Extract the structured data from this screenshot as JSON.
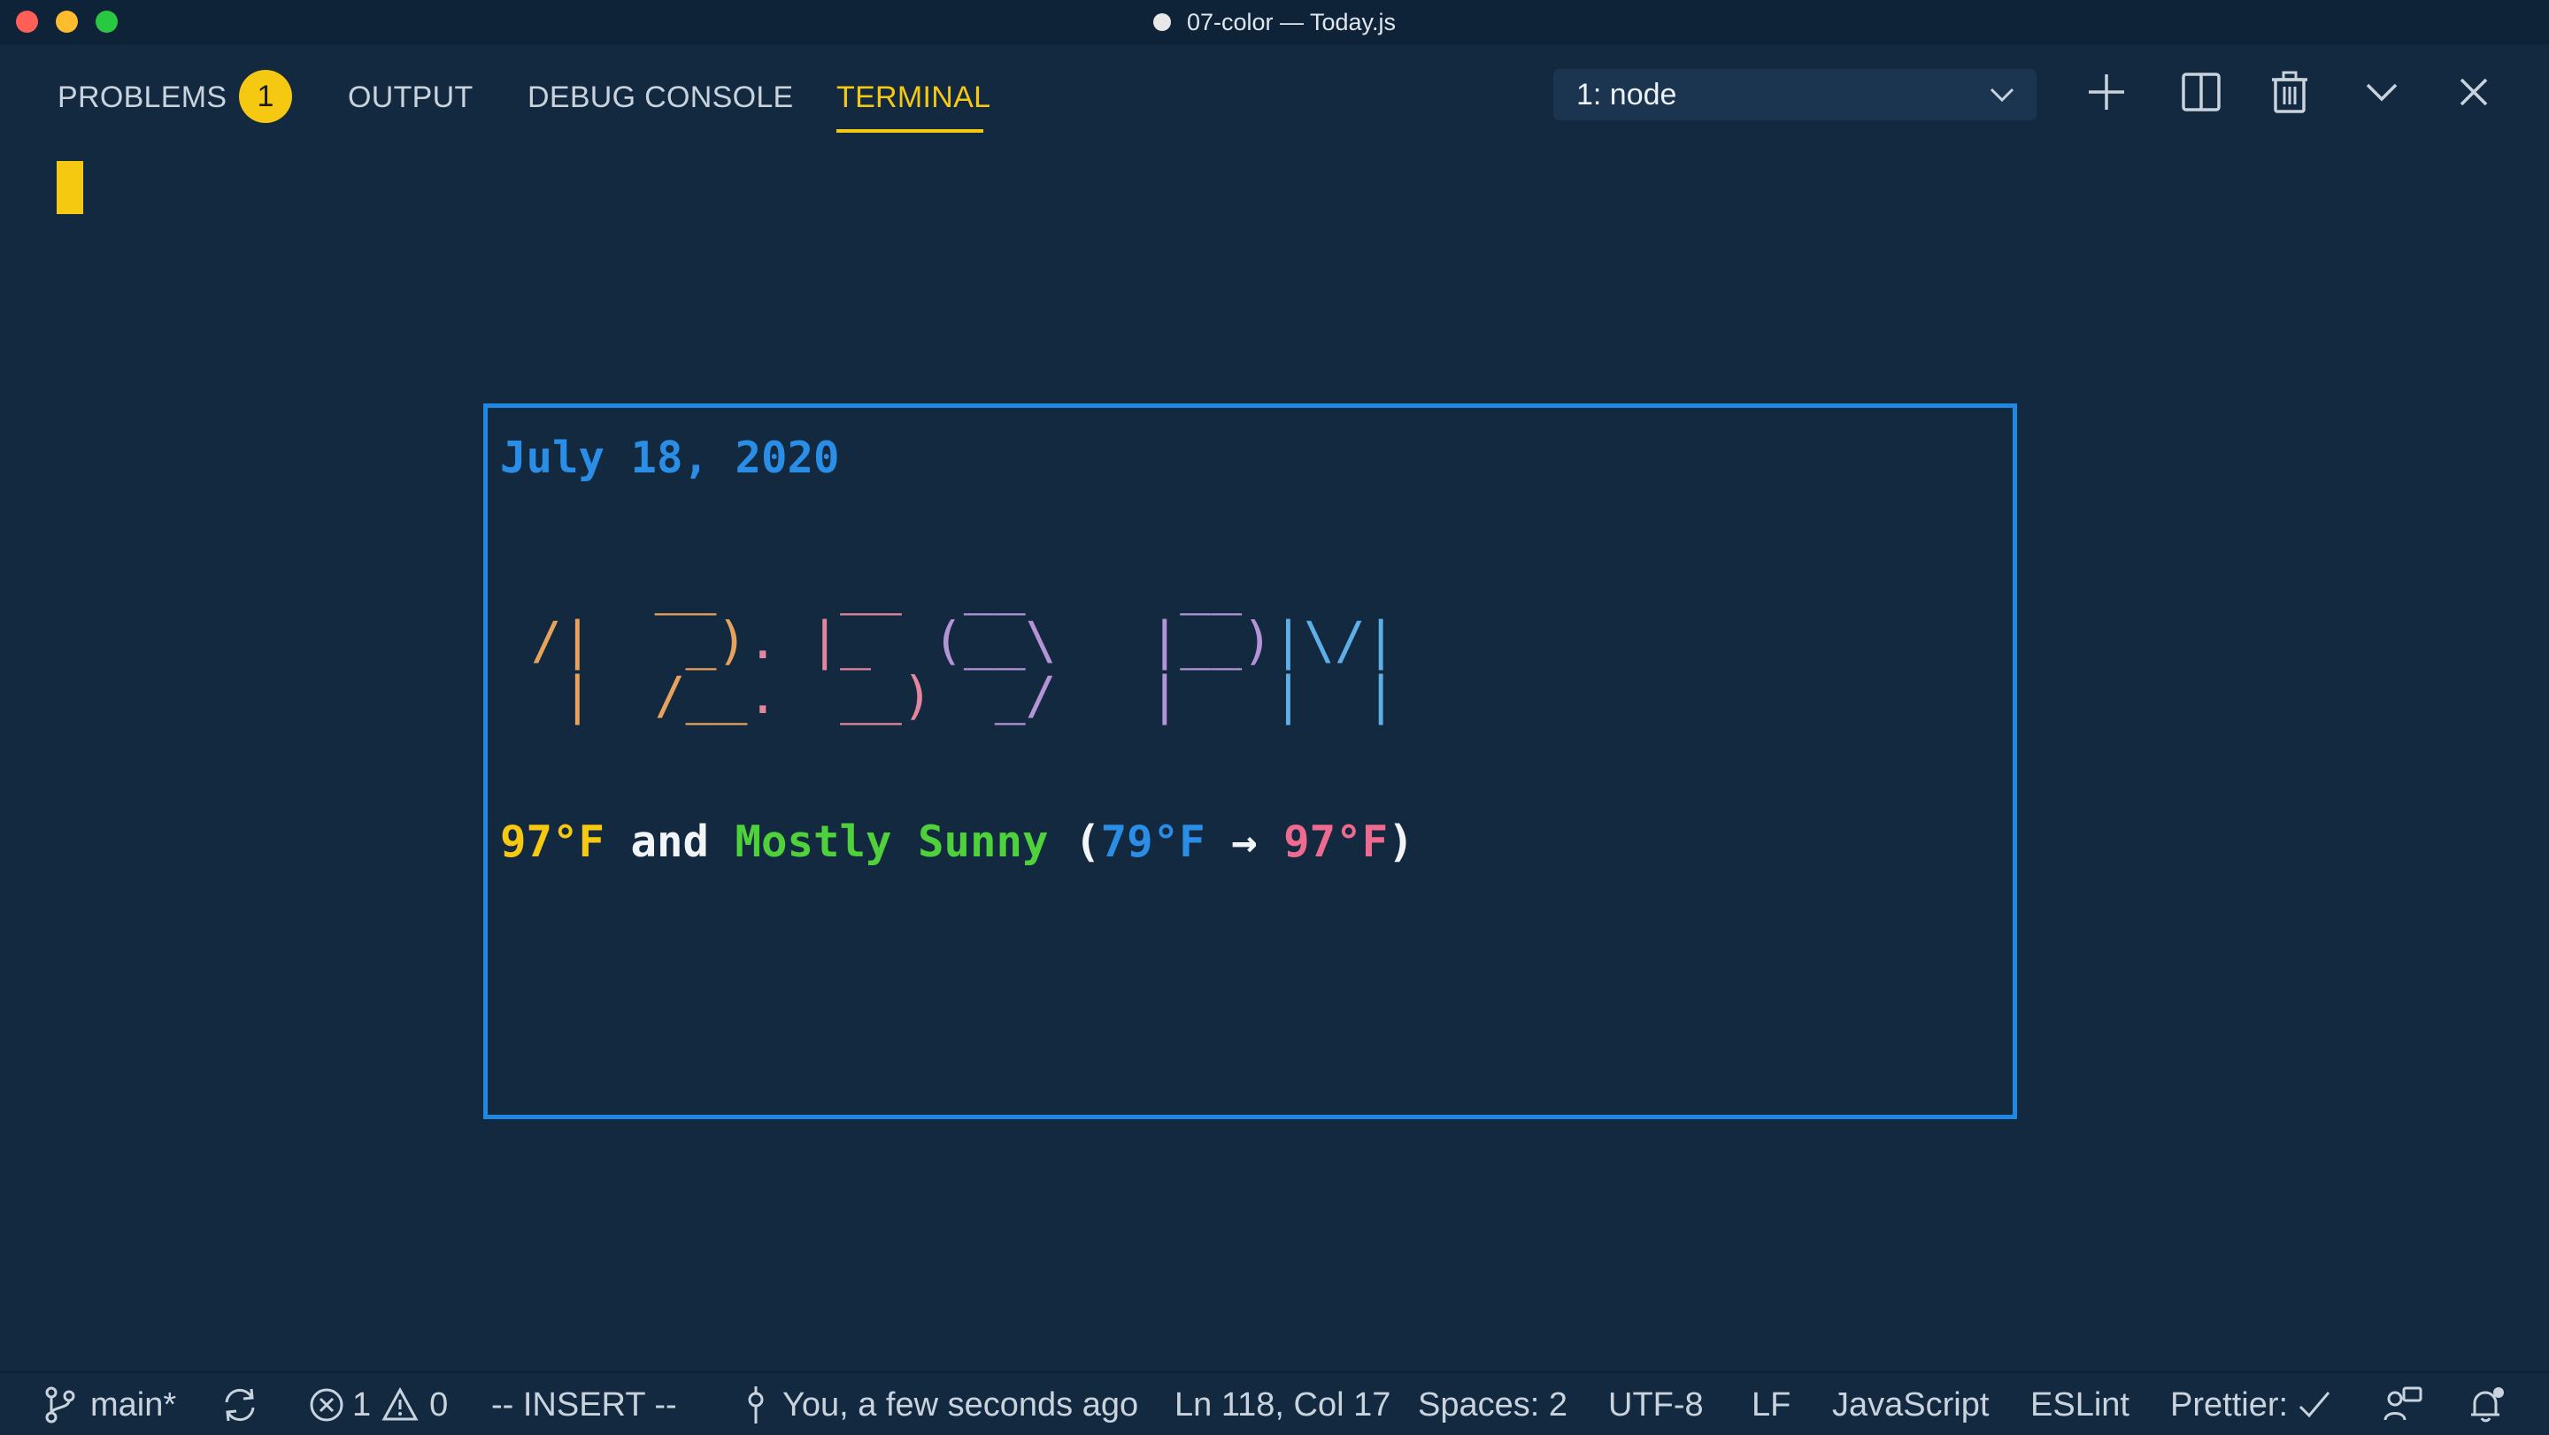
{
  "window": {
    "title": "07-color — Today.js"
  },
  "panel": {
    "tabs": {
      "problems": "PROBLEMS",
      "output": "OUTPUT",
      "debug_console": "DEBUG CONSOLE",
      "terminal": "TERMINAL"
    },
    "problems_badge": "1",
    "active_tab": "TERMINAL",
    "terminal_selector": "1: node"
  },
  "terminal": {
    "date": "July 18, 2020",
    "clock_value": "12:59 PM",
    "clock_ascii": {
      "row1": {
        "hour1": "    ",
        "hour2": " __ ",
        "colon": "  ",
        "min1": " __ ",
        "min2": " __  ",
        "space": "  ",
        "p": " __ ",
        "m": "    "
      },
      "row2": {
        "hour1": " /| ",
        "hour2": "  _)",
        "colon": ". ",
        "min1": "|_  ",
        "min2": "(__\\ ",
        "space": "  ",
        "p": "|__)",
        "m": "|\\/|"
      },
      "row3": {
        "hour1": "  | ",
        "hour2": " /__",
        "colon": ". ",
        "min1": " __)",
        "min2": "  _/ ",
        "space": "  ",
        "p": "|   ",
        "m": "|  |"
      }
    },
    "weather": {
      "current_temp": "97°F",
      "connector": " and ",
      "condition": "Mostly Sunny",
      "open_paren": " (",
      "low_temp": "79°F",
      "arrow": " → ",
      "high_temp": "97°F",
      "close_paren": ")"
    }
  },
  "statusbar": {
    "branch": "main*",
    "errors": "1",
    "warnings": "0",
    "mode": "-- INSERT --",
    "blame": "You, a few seconds ago",
    "position": "Ln 118, Col 17",
    "spaces": "Spaces: 2",
    "encoding": "UTF-8",
    "eol": "LF",
    "language": "JavaScript",
    "linter": "ESLint",
    "prettier": "Prettier:"
  },
  "colors": {
    "accent_yellow": "#f5c812",
    "widget_border": "#1f88e5",
    "date_blue": "#2b8ee6",
    "clock_orange": "#e8a25c",
    "clock_pink": "#e3869e",
    "clock_purple": "#b493d6",
    "clock_blue": "#5eaee8",
    "weather_green": "#4ed13b",
    "weather_pink": "#ee6b8f",
    "background": "#12293f"
  },
  "icons": {
    "problems_badge": "count-badge",
    "selector": "chevron-down-icon",
    "add": "plus-icon",
    "split": "split-terminal-icon",
    "kill": "trash-icon",
    "maximize": "chevron-down-icon",
    "close": "close-icon",
    "branch": "git-branch-icon",
    "sync": "sync-icon",
    "errors": "error-circle-icon",
    "warnings": "warning-triangle-icon",
    "blame": "git-commit-icon",
    "prettier": "check-icon",
    "feedback": "feedback-icon",
    "notifications": "bell-icon"
  }
}
